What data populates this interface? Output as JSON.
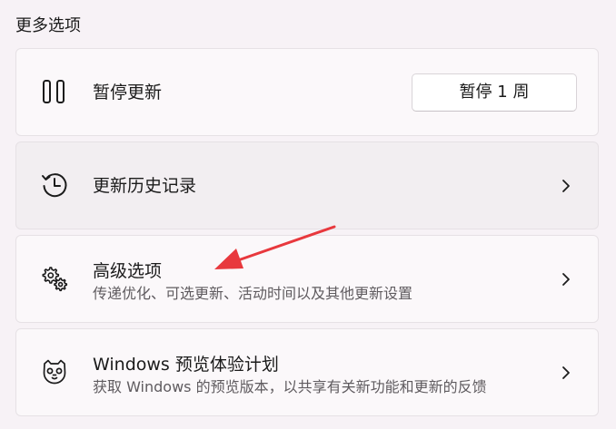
{
  "section": {
    "title": "更多选项"
  },
  "cards": [
    {
      "label": "暂停更新",
      "icon": "pause-icon",
      "button_label": "暂停 1 周"
    },
    {
      "label": "更新历史记录",
      "icon": "history-icon"
    },
    {
      "label": "高级选项",
      "description": "传递优化、可选更新、活动时间以及其他更新设置",
      "icon": "gears-icon"
    },
    {
      "label": "Windows 预览体验计划",
      "description": "获取 Windows 的预览版本，以共享有关新功能和更新的反馈",
      "icon": "insider-cat-icon"
    }
  ],
  "colors": {
    "background": "#f7f2f6",
    "card": "#fbf8fa",
    "card_hover": "#f2eef1",
    "annotation_arrow": "#e8383d"
  }
}
